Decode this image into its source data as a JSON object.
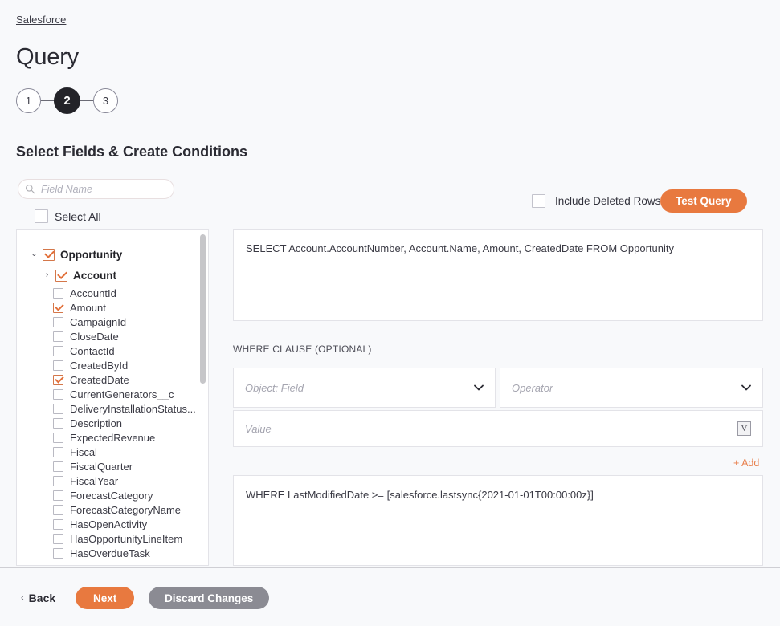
{
  "breadcrumb": {
    "label": "Salesforce"
  },
  "header": {
    "title": "Query"
  },
  "stepper": {
    "steps": [
      {
        "label": "1",
        "active": false
      },
      {
        "label": "2",
        "active": true
      },
      {
        "label": "3",
        "active": false
      }
    ]
  },
  "section": {
    "heading": "Select Fields & Create Conditions"
  },
  "search": {
    "placeholder": "Field Name",
    "value": "",
    "icon": "search-icon"
  },
  "select_all": {
    "label": "Select All",
    "checked": false
  },
  "include_deleted": {
    "label": "Include Deleted Rows",
    "checked": false
  },
  "test_query": {
    "label": "Test Query"
  },
  "tree": {
    "nodes": [
      {
        "label": "Opportunity",
        "level": "root",
        "checked": true,
        "caret": "⌄",
        "expanded": true
      },
      {
        "label": "Account",
        "level": "child",
        "checked": true,
        "caret": "›",
        "expanded": false
      },
      {
        "label": "AccountId",
        "level": "leaf",
        "checked": false
      },
      {
        "label": "Amount",
        "level": "leaf",
        "checked": true
      },
      {
        "label": "CampaignId",
        "level": "leaf",
        "checked": false
      },
      {
        "label": "CloseDate",
        "level": "leaf",
        "checked": false
      },
      {
        "label": "ContactId",
        "level": "leaf",
        "checked": false
      },
      {
        "label": "CreatedById",
        "level": "leaf",
        "checked": false
      },
      {
        "label": "CreatedDate",
        "level": "leaf",
        "checked": true
      },
      {
        "label": "CurrentGenerators__c",
        "level": "leaf",
        "checked": false
      },
      {
        "label": "DeliveryInstallationStatus...",
        "level": "leaf",
        "checked": false
      },
      {
        "label": "Description",
        "level": "leaf",
        "checked": false
      },
      {
        "label": "ExpectedRevenue",
        "level": "leaf",
        "checked": false
      },
      {
        "label": "Fiscal",
        "level": "leaf",
        "checked": false
      },
      {
        "label": "FiscalQuarter",
        "level": "leaf",
        "checked": false
      },
      {
        "label": "FiscalYear",
        "level": "leaf",
        "checked": false
      },
      {
        "label": "ForecastCategory",
        "level": "leaf",
        "checked": false
      },
      {
        "label": "ForecastCategoryName",
        "level": "leaf",
        "checked": false
      },
      {
        "label": "HasOpenActivity",
        "level": "leaf",
        "checked": false
      },
      {
        "label": "HasOpportunityLineItem",
        "level": "leaf",
        "checked": false
      },
      {
        "label": "HasOverdueTask",
        "level": "leaf",
        "checked": false
      }
    ]
  },
  "sql": {
    "statement": "SELECT Account.AccountNumber, Account.Name, Amount, CreatedDate FROM Opportunity"
  },
  "where": {
    "section_label": "WHERE CLAUSE (OPTIONAL)",
    "field_placeholder": "Object: Field",
    "field_value": "",
    "operator_placeholder": "Operator",
    "operator_value": "",
    "value_placeholder": "Value",
    "value_value": "",
    "variable_button": "V",
    "add_label": "+ Add",
    "result": "WHERE LastModifiedDate >= [salesforce.lastsync{2021-01-01T00:00:00z}]"
  },
  "footer": {
    "back_label": "Back",
    "back_caret": "‹",
    "next_label": "Next",
    "discard_label": "Discard Changes"
  },
  "colors": {
    "accent_orange": "#e8793f",
    "checkbox_check": "#e2703a",
    "step_active_bg": "#232328",
    "discard_gray": "#8b8b93",
    "page_bg": "#f8f9fb"
  }
}
